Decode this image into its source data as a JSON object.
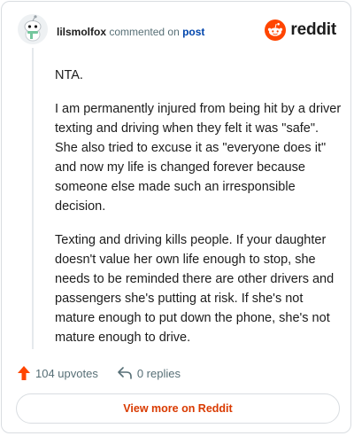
{
  "comment": {
    "username": "lilsmolfox",
    "commented_on_text": "commented on",
    "post_link": "post",
    "paragraphs": [
      "NTA.",
      "I am permanently injured from being hit by a driver texting and driving when they felt it was \"safe\". She also tried to excuse it as \"everyone does it\" and now my life is changed forever because someone else made such an irresponsible decision.",
      "Texting and driving kills people. If your daughter doesn't value her own life enough to stop, she needs to be reminded there are other drivers and passengers she's putting at risk. If she's not mature enough to put down the phone, she's not mature enough to drive."
    ],
    "upvotes": "104 upvotes",
    "replies": "0 replies"
  },
  "brand": {
    "name": "reddit",
    "icon": "reddit-logo-icon",
    "color": "#ff4500"
  },
  "footer": {
    "view_more_label": "View more on Reddit"
  },
  "colors": {
    "accent": "#d93a00",
    "link": "#0045ac",
    "muted": "#576f76",
    "upvote": "#ff4500"
  }
}
